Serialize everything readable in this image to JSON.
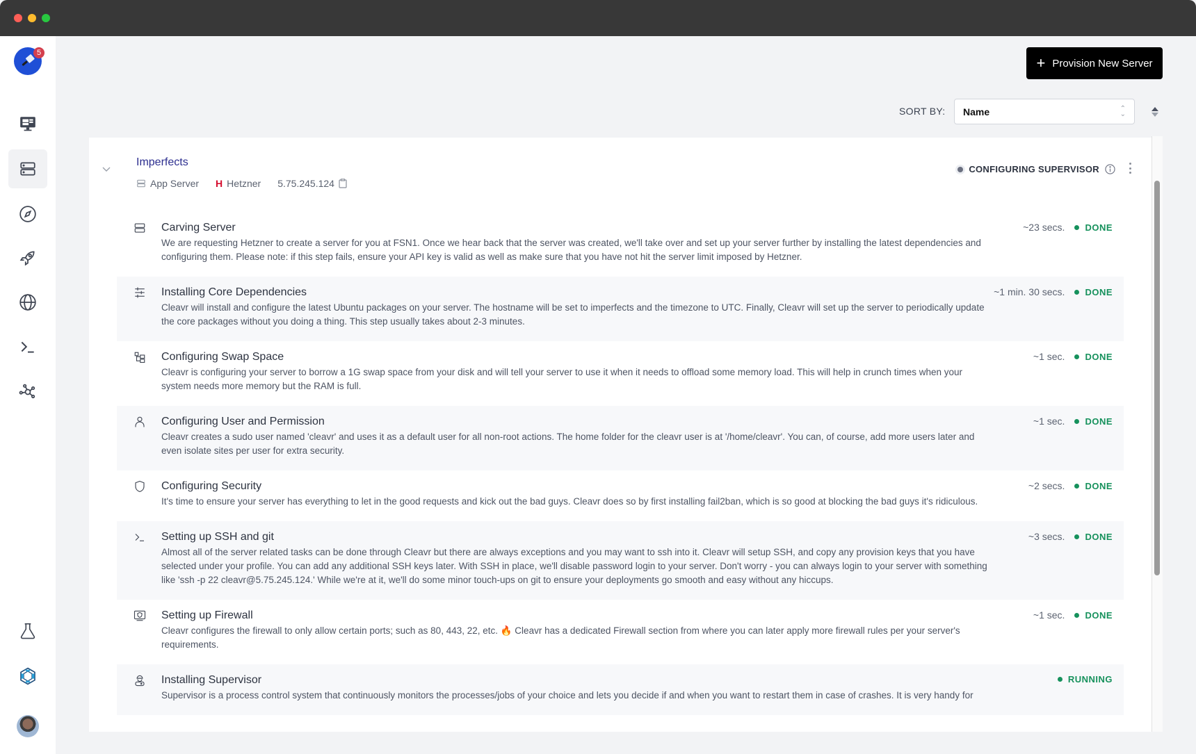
{
  "window": {
    "traffic_lights": [
      "close",
      "minimize",
      "maximize"
    ]
  },
  "sidebar": {
    "logo": {
      "icon": "cleaver-icon",
      "badge": "5",
      "color": "#1f4fd6"
    },
    "items": [
      {
        "name": "dashboard",
        "icon": "monitor-icon",
        "active": false
      },
      {
        "name": "servers",
        "icon": "server-icon",
        "active": true
      },
      {
        "name": "explore",
        "icon": "compass-icon",
        "active": false
      },
      {
        "name": "deployments",
        "icon": "rocket-icon",
        "active": false
      },
      {
        "name": "domains",
        "icon": "globe-icon",
        "active": false
      },
      {
        "name": "terminal",
        "icon": "terminal-icon",
        "active": false
      },
      {
        "name": "network",
        "icon": "network-icon",
        "active": false
      }
    ],
    "bottom_items": [
      {
        "name": "labs",
        "icon": "flask-icon"
      },
      {
        "name": "integration",
        "icon": "hexagon-logo-icon"
      },
      {
        "name": "profile",
        "icon": "avatar"
      }
    ]
  },
  "toolbar": {
    "provision_label": "Provision New Server",
    "sort_label": "SORT BY:",
    "sort_value": "Name"
  },
  "server": {
    "name": "Imperfects",
    "type": "App Server",
    "provider": "Hetzner",
    "provider_logo": "H",
    "ip": "5.75.245.124",
    "status": "CONFIGURING SUPERVISOR",
    "steps": [
      {
        "icon": "server-icon",
        "title": "Carving Server",
        "desc": "We are requesting Hetzner to create a server for you at FSN1. Once we hear back that the server was created, we'll take over and set up your server further by installing the latest dependencies and configuring them. Please note: if this step fails, ensure your API key is valid as well as make sure that you have not hit the server limit imposed by Hetzner.",
        "duration": "~23 secs.",
        "state": "DONE"
      },
      {
        "icon": "sliders-icon",
        "title": "Installing Core Dependencies",
        "desc": "Cleavr will install and configure the latest Ubuntu packages on your server. The hostname will be set to imperfects and the timezone to UTC. Finally, Cleavr will set up the server to periodically update the core packages without you doing a thing. This step usually takes about 2-3 minutes.",
        "duration": "~1 min. 30 secs.",
        "state": "DONE"
      },
      {
        "icon": "swap-icon",
        "title": "Configuring Swap Space",
        "desc": "Cleavr is configuring your server to borrow a 1G swap space from your disk and will tell your server to use it when it needs to offload some memory load. This will help in crunch times when your system needs more memory but the RAM is full.",
        "duration": "~1 sec.",
        "state": "DONE"
      },
      {
        "icon": "user-icon",
        "title": "Configuring User and Permission",
        "desc": "Cleavr creates a sudo user named 'cleavr' and uses it as a default user for all non-root actions. The home folder for the cleavr user is at '/home/cleavr'. You can, of course, add more users later and even isolate sites per user for extra security.",
        "duration": "~1 sec.",
        "state": "DONE"
      },
      {
        "icon": "shield-icon",
        "title": "Configuring Security",
        "desc": "It's time to ensure your server has everything to let in the good requests and kick out the bad guys. Cleavr does so by first installing fail2ban, which is so good at blocking the bad guys it's ridiculous.",
        "duration": "~2 secs.",
        "state": "DONE"
      },
      {
        "icon": "terminal-icon",
        "title": "Setting up SSH and git",
        "desc": "Almost all of the server related tasks can be done through Cleavr but there are always exceptions and you may want to ssh into it. Cleavr will setup SSH, and copy any provision keys that you have selected under your profile. You can add any additional SSH keys later. With SSH in place, we'll disable password login to your server. Don't worry - you can always login to your server with something like 'ssh -p 22 cleavr@5.75.245.124.' While we're at it, we'll do some minor touch-ups on git to ensure your deployments go smooth and easy without any hiccups.",
        "duration": "~3 secs.",
        "state": "DONE"
      },
      {
        "icon": "firewall-icon",
        "title": "Setting up Firewall",
        "desc": "Cleavr configures the firewall to only allow certain ports; such as 80, 443, 22, etc. 🔥 Cleavr has a dedicated Firewall section from where you can later apply more firewall rules per your server's requirements.",
        "duration": "~1 sec.",
        "state": "DONE"
      },
      {
        "icon": "supervisor-icon",
        "title": "Installing Supervisor",
        "desc": "Supervisor is a process control system that continuously monitors the processes/jobs of your choice and lets you decide if and when you want to restart them in case of crashes. It is very handy for",
        "duration": "",
        "state": "RUNNING"
      }
    ]
  },
  "colors": {
    "done": "#16915c",
    "running": "#16915c",
    "server_name": "#2c2e8f",
    "hetzner": "#d50c2d",
    "button_bg": "#000000"
  }
}
